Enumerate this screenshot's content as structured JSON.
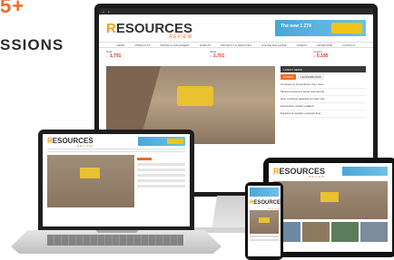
{
  "headline": {
    "line1": "5+",
    "line2": "SSIONS"
  },
  "brand": {
    "logo_first": "R",
    "logo_rest": "ESOURCES",
    "logo_sub": "REVIEW"
  },
  "monitor": {
    "ad_text": "The new 1 274",
    "nav": [
      "NEWS",
      "PRODUCTS",
      "MINING & MACHINERY",
      "EVENTS",
      "PRODUCT & SERVICES",
      "ONLINE MAGAZINE",
      "VIDEOS",
      "ADVERTISE",
      "CONTACT"
    ],
    "tickers": [
      {
        "name": "Gold",
        "value": "↓ 1,791"
      },
      {
        "name": "Silver",
        "value": "↓ 1,701"
      },
      {
        "name": "Copper",
        "value": "↓ 0,195"
      }
    ],
    "sidebar_title": "LATEST NEWS",
    "sidebar_tabs": [
      "LATEST",
      "LEADERBOARD"
    ],
    "sidebar_items": [
      "Company to bring lithium from mine",
      "Mining investment boost announced",
      "New contracts awarded at major site",
      "Exploration results updated",
      "Equipment supplier expands fleet"
    ]
  }
}
